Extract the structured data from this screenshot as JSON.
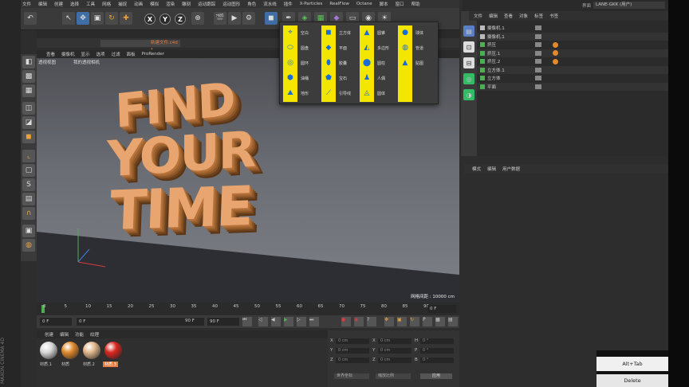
{
  "menubar": {
    "items": [
      "文件",
      "编辑",
      "创建",
      "选择",
      "工具",
      "网格",
      "捕捉",
      "动画",
      "模拟",
      "渲染",
      "雕刻",
      "运动跟踪",
      "运动图形",
      "角色",
      "流水线",
      "插件",
      "X-Particles",
      "RealFlow",
      "Octane",
      "脚本",
      "窗口",
      "帮助"
    ]
  },
  "layout_label": "界面",
  "layout_value": "LANE-GKK (用户)",
  "document": {
    "tab_name": "新建文件.c4d *"
  },
  "viewport": {
    "menu": [
      "查看",
      "摄像机",
      "显示",
      "选项",
      "过滤",
      "面板",
      "ProRender"
    ],
    "view_name": "透视视图",
    "camera_name": "我的透视相机",
    "scene_text": [
      "FIND",
      "YOUR",
      "TIME"
    ],
    "grid_spacing": "网格间距 : 10000 cm"
  },
  "popup": {
    "items": [
      {
        "label": "空白",
        "icon": "null-icon"
      },
      {
        "label": "圆盘",
        "icon": "disc-icon"
      },
      {
        "label": "圆环",
        "icon": "torus-icon"
      },
      {
        "label": "油桶",
        "icon": "oil-tank-icon"
      },
      {
        "label": "地形",
        "icon": "landscape-icon"
      },
      {
        "label": "立方体",
        "icon": "cube-icon"
      },
      {
        "label": "平面",
        "icon": "plane-icon"
      },
      {
        "label": "胶囊",
        "icon": "capsule-icon"
      },
      {
        "label": "宝石",
        "icon": "gem-icon"
      },
      {
        "label": "引导线",
        "icon": "guide-icon"
      },
      {
        "label": "圆锥",
        "icon": "cone-icon"
      },
      {
        "label": "多边形",
        "icon": "polygon-icon"
      },
      {
        "label": "圆柱",
        "icon": "cylinder-icon"
      },
      {
        "label": "人偶",
        "icon": "figure-icon"
      },
      {
        "label": "圆体",
        "icon": "pyramid-alt-icon"
      },
      {
        "label": "球体",
        "icon": "sphere-icon"
      },
      {
        "label": "管道",
        "icon": "tube-icon"
      },
      {
        "label": "贴图",
        "icon": "pyramid-icon"
      }
    ]
  },
  "timeline": {
    "ticks": [
      "0",
      "5",
      "10",
      "15",
      "20",
      "25",
      "30",
      "35",
      "40",
      "45",
      "50",
      "55",
      "60",
      "65",
      "70",
      "75",
      "80",
      "85",
      "90"
    ]
  },
  "playbar": {
    "start": "0 F",
    "current": "0 F",
    "end_a": "90 F",
    "end_b": "90 F",
    "frame": "0 F"
  },
  "materials": {
    "menu": [
      "创建",
      "编辑",
      "功能",
      "纹理"
    ],
    "items": [
      {
        "label": "材质.1",
        "color": "#d8d8d8"
      },
      {
        "label": "材质",
        "color": "#e08a2c"
      },
      {
        "label": "材质.2",
        "color": "#e0b58a"
      },
      {
        "label": "材质.3",
        "color": "#d8261f"
      }
    ]
  },
  "coords": {
    "rows": [
      {
        "a": "X",
        "av": "0 cm",
        "b": "X",
        "bv": "0 cm",
        "c": "H",
        "cv": "0 °"
      },
      {
        "a": "Y",
        "av": "0 cm",
        "b": "Y",
        "bv": "0 cm",
        "c": "P",
        "cv": "0 °"
      },
      {
        "a": "Z",
        "av": "0 cm",
        "b": "Z",
        "bv": "0 cm",
        "c": "B",
        "cv": "0 °"
      }
    ],
    "mode_a": "世界坐标",
    "mode_b": "缩放比例",
    "apply": "应用"
  },
  "objects": {
    "menu": [
      "文件",
      "编辑",
      "查看",
      "对象",
      "标签",
      "书签"
    ],
    "rows": [
      "摄像机.1",
      "摄像机.1",
      "挤压",
      "挤压.1",
      "挤压.2",
      "立方体.1",
      "立方体",
      "平面"
    ]
  },
  "attributes": {
    "menu": [
      "模式",
      "编辑",
      "用户数据"
    ]
  },
  "buttons": {
    "alt_tab": "Alt+Tab",
    "delete": "Delete"
  },
  "brand": "MAXON CINEMA 4D",
  "colors": {
    "accent": "#f5e600",
    "orange": "#e87b3b",
    "blue": "#3f6ea6"
  }
}
